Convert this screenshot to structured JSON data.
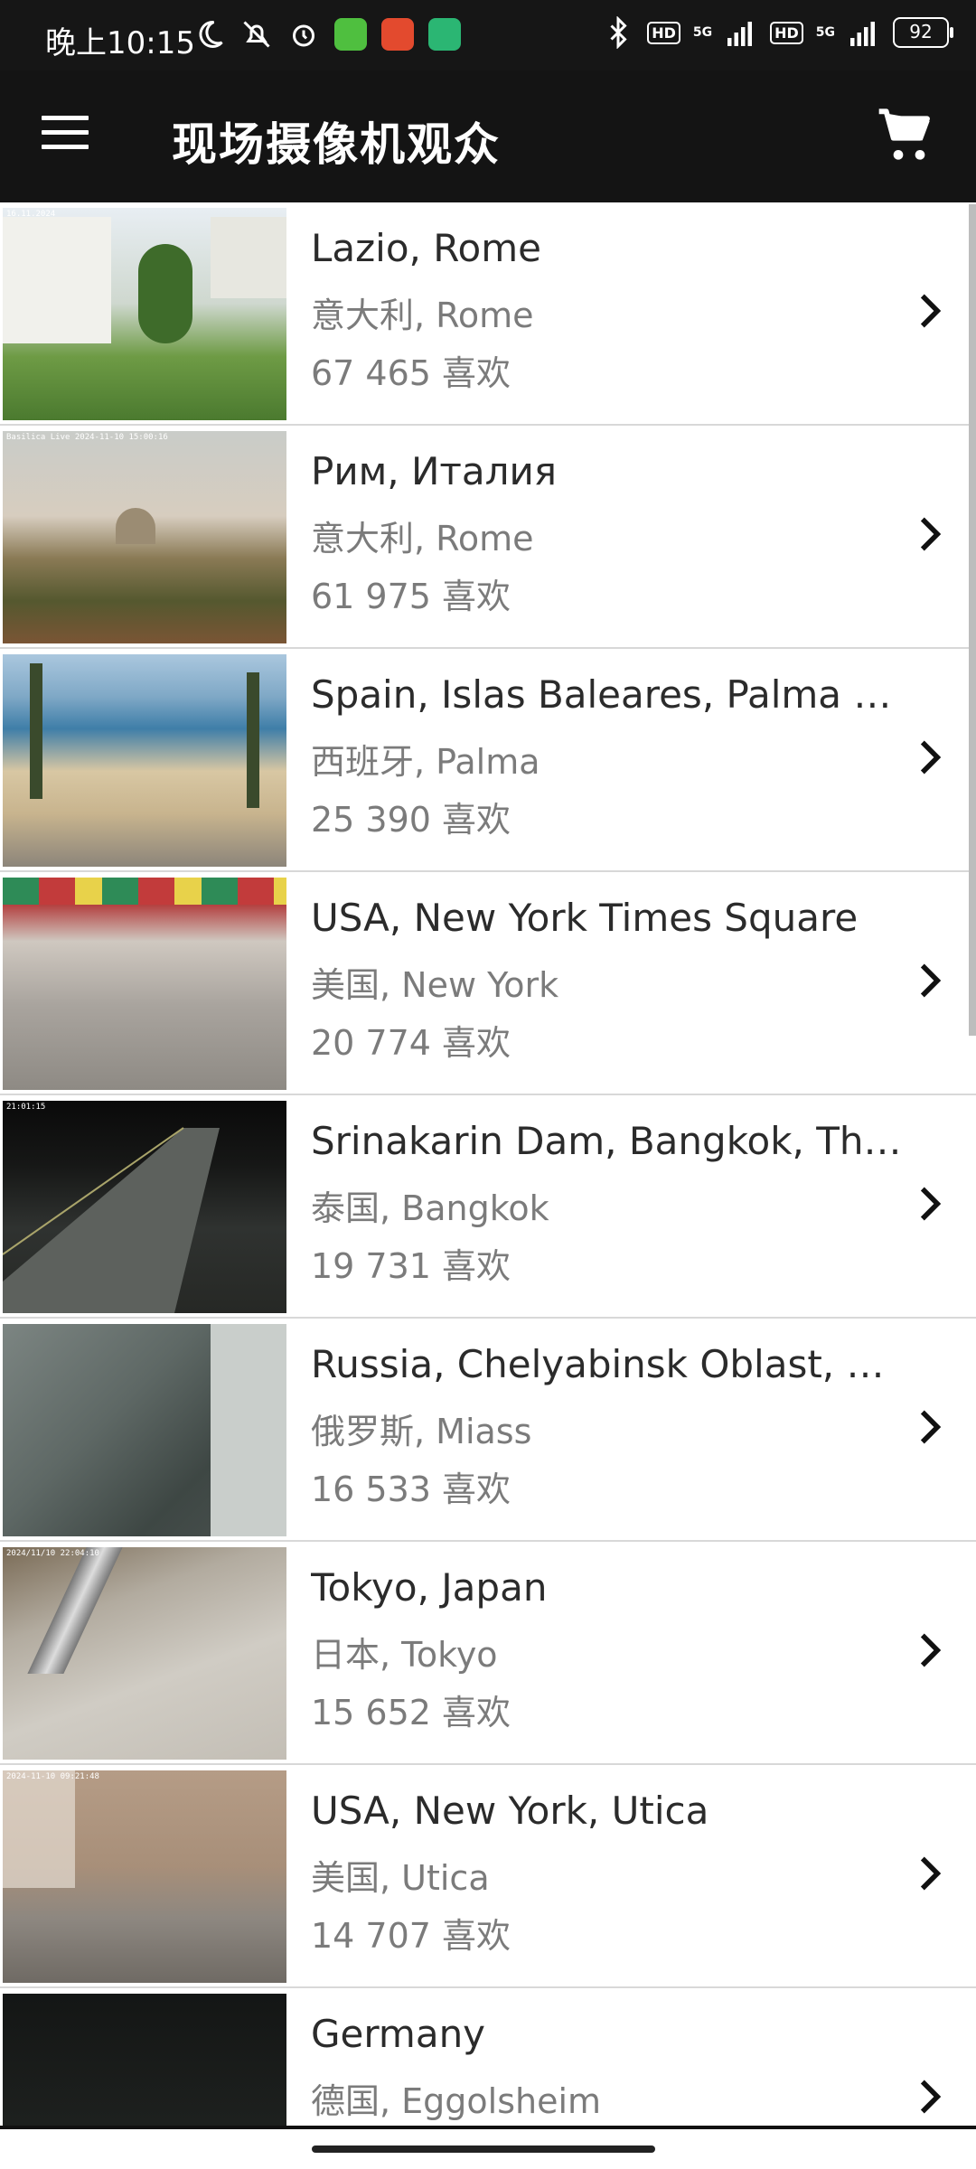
{
  "status_bar": {
    "time": "晚上10:15",
    "battery": "92",
    "hd1": "HD",
    "hd2": "HD",
    "net1": "5G",
    "net2": "5G"
  },
  "app_bar": {
    "title": "现场摄像机观众"
  },
  "list": [
    {
      "title": "Lazio, Rome",
      "subtitle": "意大利, Rome",
      "likes": "67 465 喜欢",
      "timestamp": "16.11.2024"
    },
    {
      "title": "Рим, Италия",
      "subtitle": "意大利, Rome",
      "likes": "61 975 喜欢",
      "timestamp": "Basilica Live 2024-11-10 15:00:16"
    },
    {
      "title": "Spain, Islas Baleares, Palma Ba…",
      "subtitle": "西班牙, Palma",
      "likes": "25 390 喜欢",
      "timestamp": ""
    },
    {
      "title": "USA, New York Times Square",
      "subtitle": "美国, New York",
      "likes": "20 774 喜欢",
      "timestamp": ""
    },
    {
      "title": "Srinakarin Dam, Bangkok, Thai…",
      "subtitle": "泰国, Bangkok",
      "likes": "19 731 喜欢",
      "timestamp": "21:01:15"
    },
    {
      "title": "Russia, Chelyabinsk Oblast, Mi…",
      "subtitle": "俄罗斯, Miass",
      "likes": "16 533 喜欢",
      "timestamp": ""
    },
    {
      "title": "Tokyo, Japan",
      "subtitle": "日本, Tokyo",
      "likes": "15 652 喜欢",
      "timestamp": "2024/11/10 22:04:10"
    },
    {
      "title": "USA, New York, Utica",
      "subtitle": "美国, Utica",
      "likes": "14 707 喜欢",
      "timestamp": "2024-11-10 09:21:48"
    },
    {
      "title": "Germany",
      "subtitle": "德国, Eggolsheim",
      "likes": "",
      "timestamp": ""
    }
  ],
  "colors": {
    "app_bar": "#141414",
    "title_text": "#2b2b2b",
    "secondary_text": "#7b7b7b",
    "divider": "#d8d8d8"
  }
}
